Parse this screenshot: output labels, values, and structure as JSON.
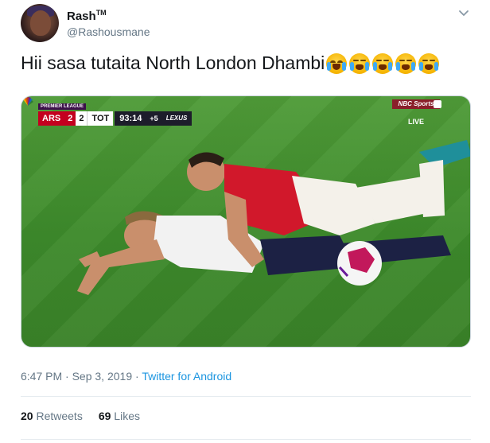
{
  "user": {
    "display_name": "Rash",
    "tm": "TM",
    "handle": "@Rashousmane"
  },
  "icons": {
    "menu": "chevron-down-icon",
    "emojis": [
      "face-with-tears-of-joy",
      "loudly-crying-face",
      "loudly-crying-face",
      "loudly-crying-face",
      "loudly-crying-face"
    ]
  },
  "tweet": {
    "text": "Hii sasa tutaita North London Dhambi"
  },
  "media": {
    "scorebug": {
      "league": "PREMIER LEAGUE",
      "home_team": "ARS",
      "home_score": "2",
      "away_score": "2",
      "away_team": "TOT",
      "clock": "93:14",
      "added_time": "+5",
      "sponsor": "LEXUS"
    },
    "live_label": "LIVE",
    "network_label": "NBC Sports"
  },
  "meta": {
    "time": "6:47 PM",
    "separator": " · ",
    "date": "Sep 3, 2019",
    "separator2": " · ",
    "source": "Twitter for Android"
  },
  "stats": {
    "retweets_count": "20",
    "retweets_label": " Retweets",
    "likes_count": "69",
    "likes_label": " Likes"
  },
  "colors": {
    "text_primary": "#14171a",
    "text_secondary": "#657786",
    "link": "#1b95e0",
    "divider": "#e6ecf0",
    "pitch": "#3d8a2b"
  }
}
